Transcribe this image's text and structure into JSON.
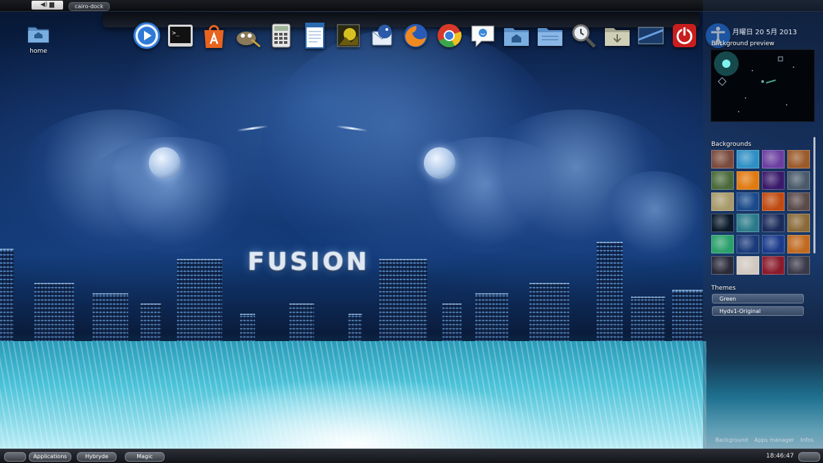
{
  "top_panel": {
    "tray_glyphs": "◀) ▆",
    "task_label": "cairo-dock"
  },
  "desktop": {
    "home_label": "home"
  },
  "wallpaper": {
    "title": "FUSION"
  },
  "dock": {
    "icons": [
      "media-player-icon",
      "terminal-icon",
      "software-center-icon",
      "gimp-icon",
      "calculator-icon",
      "text-editor-icon",
      "image-viewer-icon",
      "thunderbird-icon",
      "firefox-icon",
      "chrome-icon",
      "chat-icon",
      "home-folder-icon",
      "files-icon",
      "search-icon",
      "downloads-folder-icon",
      "screenshot-icon",
      "power-icon",
      "accessibility-icon"
    ]
  },
  "side_panel": {
    "date": "月曜日 20 5月 2013",
    "preview_title": "Background preview",
    "backgrounds_title": "Backgrounds",
    "backgrounds": [
      "#7a4a3c",
      "#2e8fc4",
      "#6a3fa0",
      "#9a5a2a",
      "#4a6a3a",
      "#e07a10",
      "#3a1a6a",
      "#4a5a6a",
      "#a89a6a",
      "#1a4a8a",
      "#c04a10",
      "#5a4a4a",
      "#0a1a2a",
      "#2a7a8a",
      "#1a2a5a",
      "#8a6a3a",
      "#2aa06a",
      "#1a3a7a",
      "#1a3a8a",
      "#c06a20",
      "#2a2a3a",
      "#d0c8c0",
      "#8a1a2a",
      "#3a3a4a"
    ],
    "themes_title": "Themes",
    "themes": [
      "Green",
      "Hydv1-Original"
    ],
    "links": [
      "Background",
      "Apps manager",
      "Infos"
    ]
  },
  "bottom_panel": {
    "applications": "Applications",
    "hybryde": "Hybryde",
    "magic": "Magic",
    "time": "18:46:47"
  }
}
